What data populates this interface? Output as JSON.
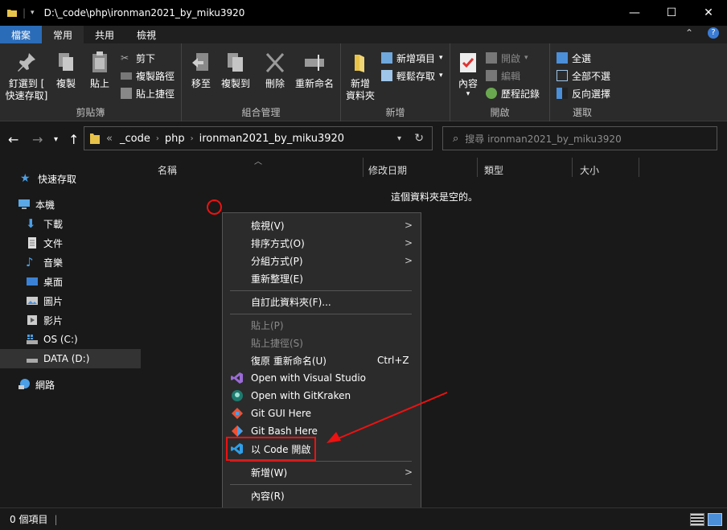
{
  "window": {
    "title": "D:\\_code\\php\\ironman2021_by_miku3920"
  },
  "ribbon_tabs": [
    "檔案",
    "常用",
    "共用",
    "檢視"
  ],
  "ribbon": {
    "clipboard": {
      "pin_label_1": "釘選到 [",
      "pin_label_2": "快速存取]",
      "copy_label": "複製",
      "paste_label": "貼上",
      "cut_label": "剪下",
      "copy_path_label": "複製路徑",
      "paste_shortcut_label": "貼上捷徑",
      "group_label": "剪貼簿"
    },
    "organize": {
      "move_label": "移至",
      "copyto_label": "複製到",
      "delete_label": "刪除",
      "rename_label": "重新命名",
      "group_label": "組合管理"
    },
    "new": {
      "newfolder_label_1": "新增",
      "newfolder_label_2": "資料夾",
      "newitem_label": "新增項目",
      "easyaccess_label": "輕鬆存取",
      "group_label": "新增"
    },
    "open": {
      "props_label": "內容",
      "open_label": "開啟",
      "edit_label": "編輯",
      "history_label": "歷程記錄",
      "group_label": "開啟"
    },
    "select": {
      "all_label": "全選",
      "none_label": "全部不選",
      "invert_label": "反向選擇",
      "group_label": "選取"
    }
  },
  "address": {
    "prefix": "«",
    "segments": [
      "_code",
      "php",
      "ironman2021_by_miku3920"
    ]
  },
  "search": {
    "placeholder": "搜尋 ironman2021_by_miku3920"
  },
  "sidebar": {
    "items": [
      {
        "label": "快速存取"
      },
      {
        "label": "本機"
      },
      {
        "label": "下載"
      },
      {
        "label": "文件"
      },
      {
        "label": "音樂"
      },
      {
        "label": "桌面"
      },
      {
        "label": "圖片"
      },
      {
        "label": "影片"
      },
      {
        "label": "OS (C:)"
      },
      {
        "label": "DATA (D:)"
      },
      {
        "label": "網路"
      }
    ]
  },
  "columns": [
    "名稱",
    "修改日期",
    "類型",
    "大小"
  ],
  "empty_message": "這個資料夾是空的。",
  "context_menu": {
    "items": [
      {
        "label": "檢視(V)"
      },
      {
        "label": "排序方式(O)"
      },
      {
        "label": "分組方式(P)"
      },
      {
        "label": "重新整理(E)"
      },
      {
        "label": "自訂此資料夾(F)..."
      },
      {
        "label": "貼上(P)"
      },
      {
        "label": "貼上捷徑(S)"
      },
      {
        "label": "復原 重新命名(U)",
        "shortcut": "Ctrl+Z"
      },
      {
        "label": "Open with Visual Studio"
      },
      {
        "label": "Open with GitKraken"
      },
      {
        "label": "Git GUI Here"
      },
      {
        "label": "Git Bash Here"
      },
      {
        "label": "以 Code 開啟"
      },
      {
        "label": "新增(W)"
      },
      {
        "label": "內容(R)"
      }
    ]
  },
  "status": {
    "count": "0 個項目"
  },
  "colors": {
    "accent": "#2b6cb8",
    "annotation": "#e11111"
  }
}
